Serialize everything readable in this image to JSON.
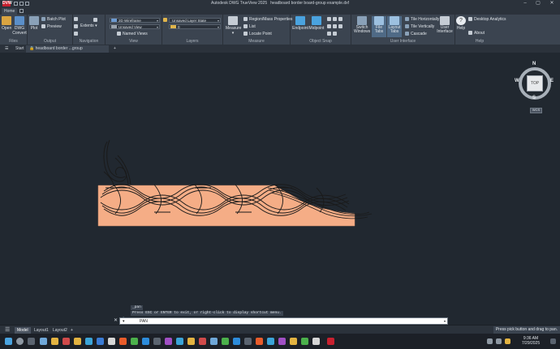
{
  "app": {
    "logo": "DVW",
    "title": "Autodesk DWG TrueView 2025",
    "document_title": "headboard border board-group example.dxf",
    "window_controls": [
      "minimize-icon",
      "maximize-icon",
      "close-icon"
    ]
  },
  "ribbon_tabs": [
    "Home"
  ],
  "ribbon": {
    "files": {
      "label": "Files",
      "open": "Open",
      "dwg_convert": "DWG Convert"
    },
    "output": {
      "label": "Output",
      "plot": "Plot",
      "batch_plot": "Batch Plot",
      "preview": "Preview"
    },
    "navigation": {
      "label": "Navigation",
      "extents": "Extents"
    },
    "view": {
      "label": "View",
      "visual_style": "2D Wireframe",
      "named_view": "Unsaved View",
      "named_views": "Named Views"
    },
    "layers": {
      "label": "Layers",
      "layer_state": "Unsaved Layer State",
      "current_layer": "0"
    },
    "measure": {
      "label": "Measure",
      "measure": "Measure",
      "region_mass": "Region/Mass Properties",
      "list": "List",
      "locate_point": "Locate Point"
    },
    "object_snap": {
      "label": "Object Snap",
      "endpoint": "Endpoint",
      "midpoint": "Midpoint"
    },
    "user_interface": {
      "label": "User Interface",
      "switch_windows": "Switch Windows",
      "file_tabs": "File Tabs",
      "layout_tabs": "Layout Tabs",
      "tile_horizontally": "Tile Horizontally",
      "tile_vertically": "Tile Vertically",
      "cascade": "Cascade",
      "user_interface": "User Interface"
    },
    "help": {
      "label": "Help",
      "help": "Help",
      "desktop_analytics": "Desktop Analytics",
      "about": "About"
    }
  },
  "file_tabs": {
    "start": "Start",
    "document": "headboard border ...group example.dxf",
    "add": "+"
  },
  "viewcube": {
    "face": "TOP",
    "north": "N",
    "south": "S",
    "east": "E",
    "west": "W",
    "wcs": "WCS"
  },
  "command": {
    "history_1": "_pan",
    "history_2": "Press ESC or ENTER to exit, or right-click to display shortcut menu.",
    "current": "PAN",
    "prompt_prefix": "▾"
  },
  "layout_tabs": [
    "Model",
    "Layout1",
    "Layout2"
  ],
  "status_message": "Press pick button and drag to pan.",
  "taskbar": {
    "time": "9:36 AM",
    "date": "7/29/2025"
  },
  "colors": {
    "wood": "#f5ad86",
    "knot": "#1a1a1a",
    "canvas": "#212830",
    "ribbon": "#3b4450"
  }
}
